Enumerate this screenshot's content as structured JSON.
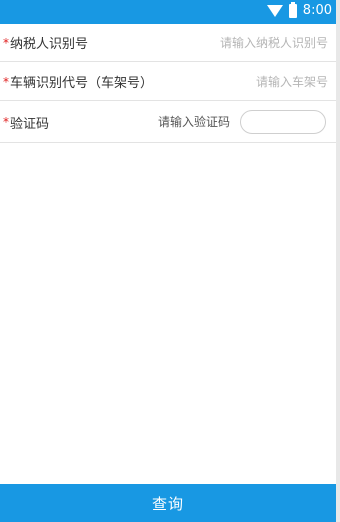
{
  "status_bar": {
    "time": "8:00",
    "icons": [
      "wifi-icon",
      "battery-icon"
    ]
  },
  "form": {
    "required_mark": "*",
    "taxpayer_id": {
      "label": "纳税人识别号",
      "placeholder": "请输入纳税人识别号",
      "value": ""
    },
    "vin": {
      "label": "车辆识别代号（车架号）",
      "placeholder": "请输入车架号",
      "value": ""
    },
    "captcha": {
      "label": "验证码",
      "placeholder": "请输入验证码",
      "value": ""
    }
  },
  "actions": {
    "query_label": "查询"
  },
  "colors": {
    "primary": "#1898e3",
    "required": "#e02020",
    "placeholder": "#b5b5b5",
    "divider": "#e3e3e3"
  }
}
